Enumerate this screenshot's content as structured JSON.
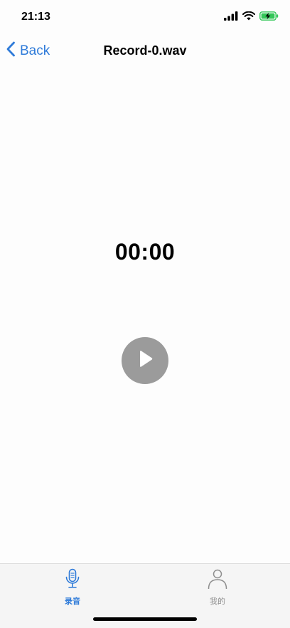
{
  "status_bar": {
    "time": "21:13",
    "icons": [
      "signal-icon",
      "wifi-icon",
      "battery-charging-icon"
    ],
    "battery_color": "#34c759"
  },
  "nav": {
    "back_label": "Back",
    "title": "Record-0.wav",
    "accent_color": "#2f7bd9"
  },
  "player": {
    "time": "00:00",
    "play_icon": "play-icon",
    "button_color": "#9b9b9b"
  },
  "tab_bar": {
    "tabs": [
      {
        "label": "录音",
        "icon": "microphone-icon",
        "selected": true
      },
      {
        "label": "我的",
        "icon": "person-icon",
        "selected": false
      }
    ]
  }
}
